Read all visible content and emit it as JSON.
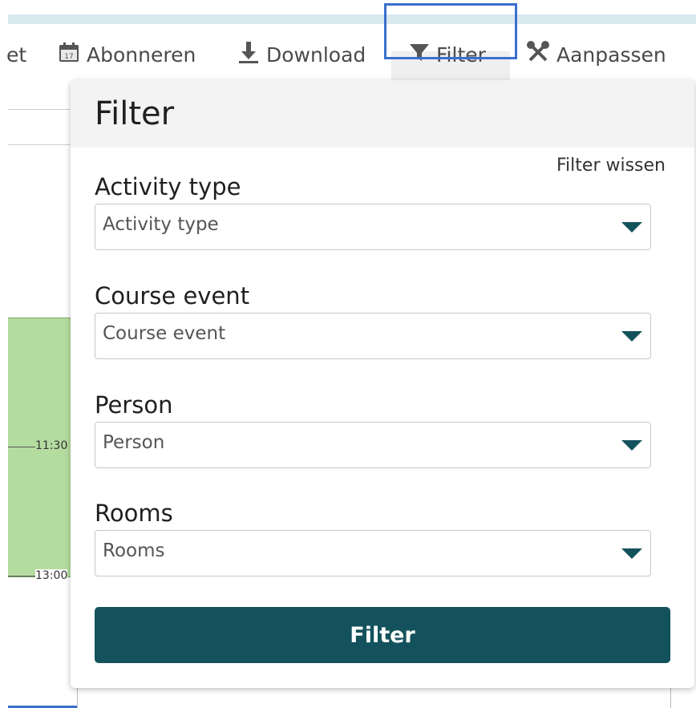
{
  "toolbar": {
    "partial_label": "et",
    "subscribe_label": "Abonneren",
    "download_label": "Download",
    "filter_label": "Filter",
    "customize_label": "Aanpassen"
  },
  "calendar": {
    "times": [
      "11:30",
      "13:00"
    ]
  },
  "panel": {
    "title": "Filter",
    "clear_label": "Filter wissen",
    "fields": [
      {
        "label": "Activity type",
        "placeholder": "Activity type"
      },
      {
        "label": "Course event",
        "placeholder": "Course event"
      },
      {
        "label": "Person",
        "placeholder": "Person"
      },
      {
        "label": "Rooms",
        "placeholder": "Rooms"
      }
    ],
    "submit_label": "Filter"
  },
  "colors": {
    "accent": "#13525c",
    "highlight": "#3a6fcf",
    "event": "#b5dca0"
  }
}
